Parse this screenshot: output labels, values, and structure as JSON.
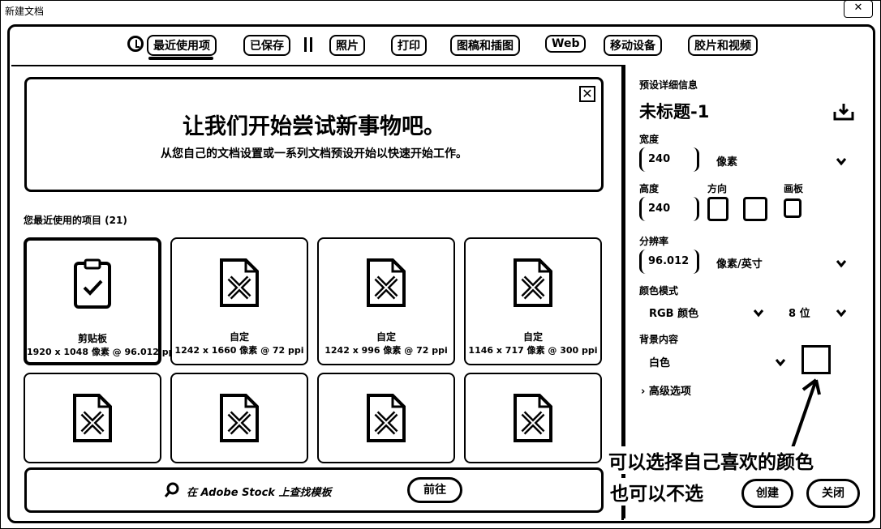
{
  "window": {
    "title": "新建文档",
    "close_label": "✕"
  },
  "tabs": [
    {
      "label": "最近使用项",
      "active": true
    },
    {
      "label": "已保存"
    },
    {
      "label": "照片"
    },
    {
      "label": "打印"
    },
    {
      "label": "图稿和插图"
    },
    {
      "label": "Web"
    },
    {
      "label": "移动设备"
    },
    {
      "label": "胶片和视频"
    }
  ],
  "welcome": {
    "heading": "让我们开始尝试新事物吧。",
    "subtext": "从您自己的文档设置或一系列文档预设开始以快速开始工作。",
    "close_label": "✕"
  },
  "recent": {
    "title": "您最近使用的项目 (21)",
    "items": [
      {
        "name": "剪贴板",
        "size": "1920 x 1048 像素 @ 96.012 ppi",
        "icon": "clipboard-check-icon"
      },
      {
        "name": "自定",
        "size": "1242 x 1660 像素 @ 72 ppi",
        "icon": "custom-doc-icon"
      },
      {
        "name": "自定",
        "size": "1242 x 996 像素 @ 72 ppi",
        "icon": "custom-doc-icon"
      },
      {
        "name": "自定",
        "size": "1146 x 717 像素 @ 300 ppi",
        "icon": "custom-doc-icon"
      },
      {
        "name": "",
        "size": "",
        "icon": "custom-doc-icon"
      },
      {
        "name": "",
        "size": "",
        "icon": "custom-doc-icon"
      },
      {
        "name": "",
        "size": "",
        "icon": "custom-doc-icon"
      },
      {
        "name": "",
        "size": "",
        "icon": "custom-doc-icon"
      }
    ]
  },
  "stock": {
    "text": "在 Adobe Stock 上查找模板",
    "go_label": "前往"
  },
  "preset": {
    "section_label": "预设详细信息",
    "doc_name": "未标题-1",
    "width_label": "宽度",
    "width_value": "240",
    "width_unit": "像素",
    "height_label": "高度",
    "height_value": "240",
    "orientation_label": "方向",
    "artboard_label": "画板",
    "resolution_label": "分辨率",
    "resolution_value": "96.012",
    "resolution_unit": "像素/英寸",
    "color_mode_label": "颜色模式",
    "color_mode_value": "RGB 颜色",
    "bit_depth_value": "8 位",
    "background_label": "背景内容",
    "background_value": "白色",
    "background_color": "#ffffff",
    "advanced_label": "高级选项"
  },
  "annotation": {
    "line1": "可以选择自己喜欢的颜色",
    "line2": "也可以不选"
  },
  "actions": {
    "create_label": "创建",
    "close_label": "关闭"
  }
}
